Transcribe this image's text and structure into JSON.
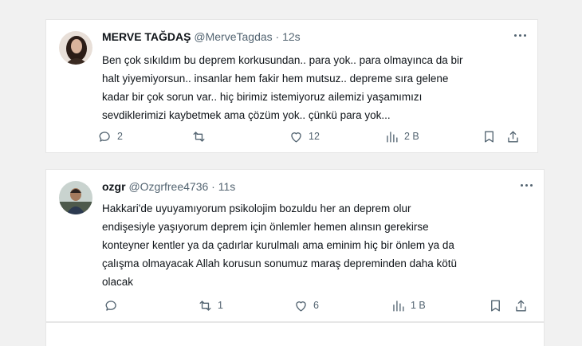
{
  "tweets": [
    {
      "name": "MERVE TAĞDAŞ",
      "handle": "@MerveTagdas",
      "separator": "·",
      "time": "12s",
      "lines": [
        "Ben çok sıkıldım bu deprem korkusundan.. para yok.. para olmayınca da bir",
        "halt yiyemiyorsun.. insanlar hem fakir hem mutsuz.. depreme sıra gelene",
        "kadar bir çok sorun var.. hiç birimiz istemiyoruz ailemizi yaşamımızı",
        "sevdiklerimizi kaybetmek ama çözüm yok.. çünkü para yok..."
      ],
      "replies": "2",
      "retweets": "",
      "likes": "12",
      "views": "2 B",
      "icons": {
        "reply": "reply-icon",
        "retweet": "retweet-icon",
        "like": "heart-icon",
        "views": "views-chart-icon",
        "bookmark": "bookmark-icon",
        "share": "share-icon",
        "more": "more-icon"
      }
    },
    {
      "name": "ozgr",
      "handle": "@Ozgrfree4736",
      "separator": "·",
      "time": "11s",
      "lines": [
        "Hakkari'de uyuyamıyorum psikolojim bozuldu her an deprem olur",
        "endişesiyle yaşıyorum deprem için önlemler hemen alınsın gerekirse",
        "konteyner kentler ya da çadırlar kurulmalı ama eminim hiç bir önlem ya da",
        "çalışma olmayacak Allah korusun sonumuz maraş depreminden daha kötü",
        "olacak"
      ],
      "replies": "",
      "retweets": "1",
      "likes": "6",
      "views": "1 B",
      "icons": {
        "reply": "reply-icon",
        "retweet": "retweet-icon",
        "like": "heart-icon",
        "views": "views-chart-icon",
        "bookmark": "bookmark-icon",
        "share": "share-icon",
        "more": "more-icon"
      }
    }
  ],
  "colors": {
    "page_background": "#f1f1f1",
    "card_background": "#ffffff",
    "text_primary": "#0f1419",
    "text_secondary": "#536471"
  }
}
